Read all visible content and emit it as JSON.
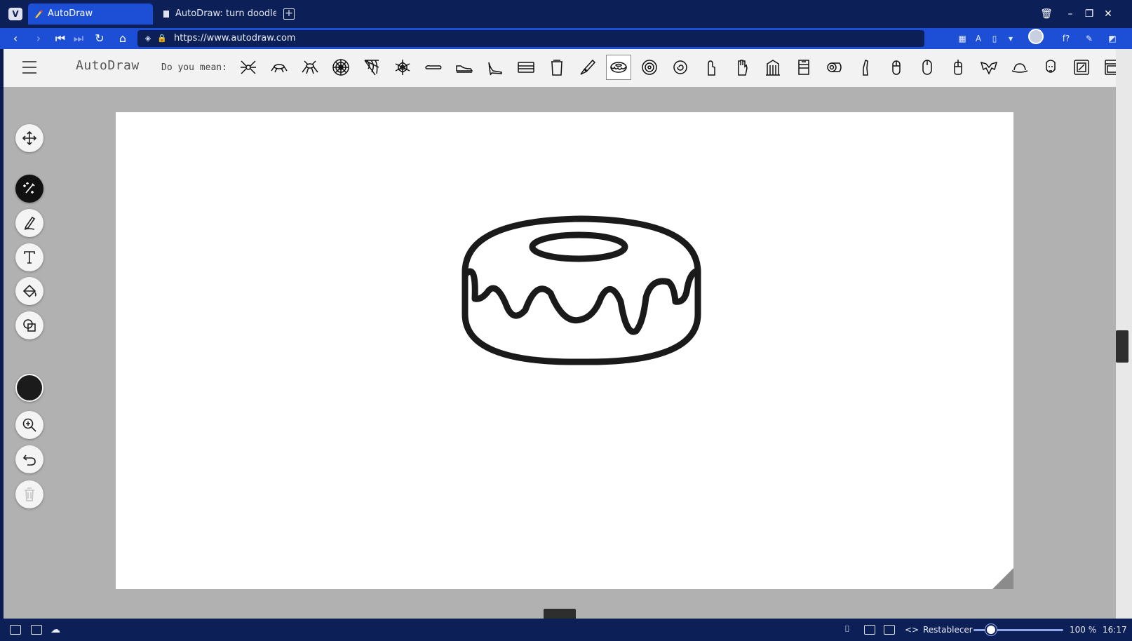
{
  "browser": {
    "tabs": [
      {
        "title": "AutoDraw",
        "active": true,
        "icon": "autodraw-favicon"
      },
      {
        "title": "AutoDraw: turn doodles in",
        "active": false,
        "icon": "page-icon"
      }
    ],
    "url": "https://www.autodraw.com",
    "window_controls": [
      "trash-icon",
      "minimize-icon",
      "restore-icon",
      "close-icon"
    ]
  },
  "app": {
    "brand": "AutoDraw",
    "suggest_label": "Do you mean:",
    "suggestions": [
      "spider-icon",
      "ant-icon",
      "bug-icon",
      "spiderweb-icon",
      "corner-web-icon",
      "web-icon",
      "skateboard-icon",
      "sneaker-icon",
      "high-heel-icon",
      "tray-icon",
      "trash-can-icon",
      "brush-icon",
      "donut-icon",
      "cookie-icon",
      "snail-icon",
      "hand-icon",
      "glove-icon",
      "building-icon",
      "tape-icon",
      "tape-roll-icon",
      "finger-icon",
      "mouse-icon",
      "computer-mouse-icon",
      "remote-icon",
      "bat-icon",
      "hat-icon",
      "face-icon",
      "frame-icon",
      "oven-icon"
    ],
    "selected_suggestion": "donut-icon",
    "tools": [
      {
        "name": "move-tool",
        "icon": "move-icon",
        "state": "normal"
      },
      {
        "name": "autodraw-tool",
        "icon": "autodraw-sparkle-icon",
        "state": "active"
      },
      {
        "name": "draw-tool",
        "icon": "pencil-icon",
        "state": "normal"
      },
      {
        "name": "type-tool",
        "icon": "text-icon",
        "state": "normal"
      },
      {
        "name": "fill-tool",
        "icon": "paint-bucket-icon",
        "state": "normal"
      },
      {
        "name": "shape-tool",
        "icon": "shapes-icon",
        "state": "normal"
      },
      {
        "name": "zoom-tool",
        "icon": "zoom-in-icon",
        "state": "normal"
      },
      {
        "name": "undo-tool",
        "icon": "undo-icon",
        "state": "normal"
      },
      {
        "name": "delete-tool",
        "icon": "trash-icon",
        "state": "disabled"
      }
    ],
    "current_color": "#1b1b1b",
    "canvas_drawing": "donut-icon"
  },
  "statusbar": {
    "reset_label": "Restablecer",
    "zoom_level": "100 %",
    "time": "16:17",
    "zoom_fraction": 0.2
  },
  "colors": {
    "chrome_dark": "#0c1f57",
    "chrome_accent": "#1c4fd6",
    "page_bg": "#b1b1b1",
    "toolbar_bg": "#f2f2f2"
  }
}
